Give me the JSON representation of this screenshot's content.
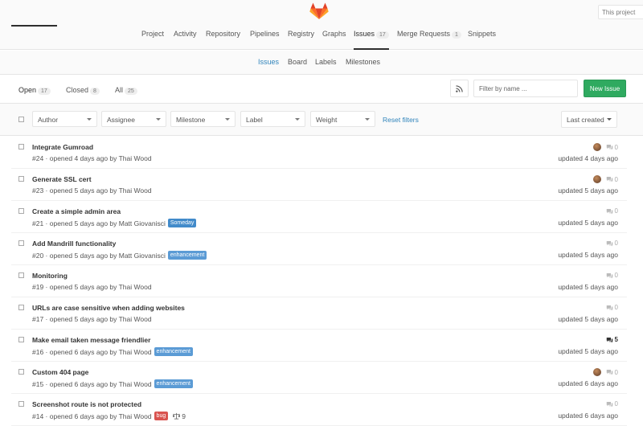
{
  "header": {
    "search_scope": "This project",
    "nav": [
      {
        "label": "Project"
      },
      {
        "label": "Activity"
      },
      {
        "label": "Repository"
      },
      {
        "label": "Pipelines"
      },
      {
        "label": "Registry"
      },
      {
        "label": "Graphs"
      },
      {
        "label": "Issues",
        "count": "17",
        "active": true
      },
      {
        "label": "Merge Requests",
        "count": "1"
      },
      {
        "label": "Snippets"
      }
    ]
  },
  "subnav": [
    {
      "label": "Issues",
      "active": true
    },
    {
      "label": "Board"
    },
    {
      "label": "Labels"
    },
    {
      "label": "Milestones"
    }
  ],
  "state_tabs": [
    {
      "label": "Open",
      "count": "17",
      "active": true
    },
    {
      "label": "Closed",
      "count": "8"
    },
    {
      "label": "All",
      "count": "25"
    }
  ],
  "actions": {
    "filter_placeholder": "Filter by name ...",
    "new_issue": "New Issue"
  },
  "filters": {
    "author": "Author",
    "assignee": "Assignee",
    "milestone": "Milestone",
    "label": "Label",
    "weight": "Weight",
    "reset": "Reset filters",
    "sort": "Last created"
  },
  "colors": {
    "accent": "#3084bb",
    "new_issue_green": "#2faa60",
    "label_someday": "#428bca",
    "label_enhancement": "#5b9bd5",
    "label_bug": "#d9534f"
  },
  "issues": [
    {
      "title": "Integrate Gumroad",
      "meta": "#24 · opened 4 days ago by Thai Wood",
      "comments": "0",
      "updated": "updated 4 days ago",
      "avatar": true
    },
    {
      "title": "Generate SSL cert",
      "meta": "#23 · opened 5 days ago by Thai Wood",
      "comments": "0",
      "updated": "updated 5 days ago",
      "avatar": true
    },
    {
      "title": "Create a simple admin area",
      "meta": "#21 · opened 5 days ago by Matt Giovanisci",
      "label": "Someday",
      "comments": "0",
      "updated": "updated 5 days ago"
    },
    {
      "title": "Add Mandrill functionality",
      "meta": "#20 · opened 5 days ago by Matt Giovanisci",
      "label": "enhancement",
      "comments": "0",
      "updated": "updated 5 days ago"
    },
    {
      "title": "Monitoring",
      "meta": "#19 · opened 5 days ago by Thai Wood",
      "comments": "0",
      "updated": "updated 5 days ago"
    },
    {
      "title": "URLs are case sensitive when adding websites",
      "meta": "#17 · opened 5 days ago by Thai Wood",
      "comments": "0",
      "updated": "updated 5 days ago"
    },
    {
      "title": "Make email taken message friendlier",
      "meta": "#16 · opened 6 days ago by Thai Wood",
      "label": "enhancement",
      "comments": "5",
      "updated": "updated 5 days ago"
    },
    {
      "title": "Custom 404 page",
      "meta": "#15 · opened 6 days ago by Thai Wood",
      "label": "enhancement",
      "comments": "0",
      "updated": "updated 6 days ago",
      "avatar": true
    },
    {
      "title": "Screenshot route is not protected",
      "meta": "#14 · opened 6 days ago by Thai Wood",
      "label": "bug",
      "weight": "9",
      "comments": "0",
      "updated": "updated 6 days ago"
    }
  ]
}
